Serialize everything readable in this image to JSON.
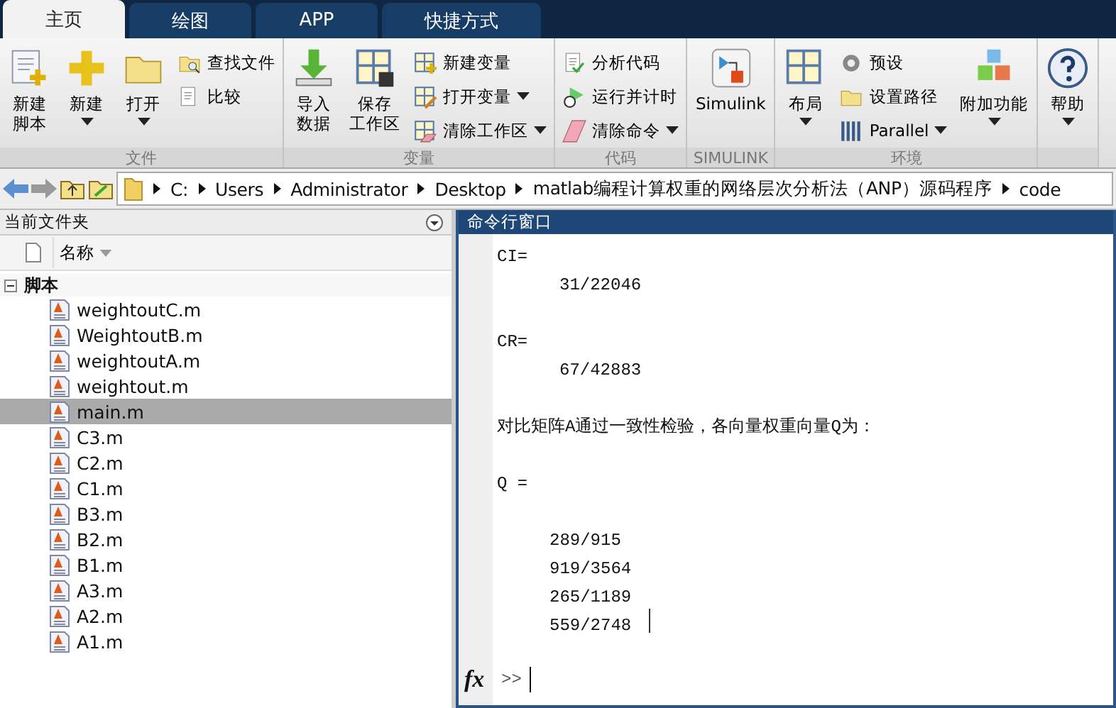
{
  "tabs": [
    {
      "label": "主页",
      "selected": true
    },
    {
      "label": "绘图",
      "selected": false
    },
    {
      "label": "APP",
      "selected": false
    },
    {
      "label": "快捷方式",
      "selected": false
    }
  ],
  "ribbon": {
    "groups": [
      {
        "label": "文件",
        "columns": [
          {
            "kind": "large",
            "items": [
              {
                "lines": [
                  "新建",
                  "脚本"
                ],
                "dropdown": false
              }
            ]
          },
          {
            "kind": "large",
            "items": [
              {
                "label": "新建",
                "dropdown": true
              }
            ]
          },
          {
            "kind": "large",
            "items": [
              {
                "label": "打开",
                "dropdown": true
              }
            ]
          },
          {
            "kind": "small",
            "items": [
              {
                "label": "查找文件",
                "dropdown": false
              },
              {
                "label": "比较",
                "dropdown": false
              }
            ]
          }
        ]
      },
      {
        "label": "变量",
        "columns": [
          {
            "kind": "large",
            "items": [
              {
                "lines": [
                  "导入",
                  "数据"
                ],
                "dropdown": false
              }
            ]
          },
          {
            "kind": "large",
            "items": [
              {
                "lines": [
                  "保存",
                  "工作区"
                ],
                "dropdown": false
              }
            ]
          },
          {
            "kind": "small",
            "items": [
              {
                "label": "新建变量",
                "dropdown": false
              },
              {
                "label": "打开变量",
                "dropdown": true
              },
              {
                "label": "清除工作区",
                "dropdown": true
              }
            ]
          }
        ]
      },
      {
        "label": "代码",
        "columns": [
          {
            "kind": "small",
            "items": [
              {
                "label": "分析代码",
                "dropdown": false
              },
              {
                "label": "运行并计时",
                "dropdown": false
              },
              {
                "label": "清除命令",
                "dropdown": true
              }
            ]
          }
        ]
      },
      {
        "label": "SIMULINK",
        "columns": [
          {
            "kind": "large",
            "items": [
              {
                "label": "Simulink",
                "dropdown": false
              }
            ]
          }
        ]
      },
      {
        "label": "环境",
        "columns": [
          {
            "kind": "large",
            "items": [
              {
                "label": "布局",
                "dropdown": true
              }
            ]
          },
          {
            "kind": "small",
            "items": [
              {
                "label": "预设",
                "dropdown": false
              },
              {
                "label": "设置路径",
                "dropdown": false
              },
              {
                "label": "Parallel",
                "dropdown": true
              }
            ]
          },
          {
            "kind": "large",
            "items": [
              {
                "label": "附加功能",
                "dropdown": true
              }
            ]
          }
        ]
      },
      {
        "columns": [
          {
            "kind": "large",
            "items": [
              {
                "label": "帮助",
                "dropdown": true
              }
            ]
          }
        ]
      }
    ]
  },
  "address": {
    "segments": [
      "C:",
      "Users",
      "Administrator",
      "Desktop",
      "matlab编程计算权重的网络层次分析法（ANP）源码程序",
      "code"
    ]
  },
  "file_panel": {
    "title": "当前文件夹",
    "column": "名称",
    "tree": [
      {
        "label": "脚本",
        "expanded": true,
        "children": [
          {
            "label": "weightoutC.m",
            "selected": false
          },
          {
            "label": "WeightoutB.m",
            "selected": false
          },
          {
            "label": "weightoutA.m",
            "selected": false
          },
          {
            "label": "weightout.m",
            "selected": false
          },
          {
            "label": "main.m",
            "selected": true
          },
          {
            "label": "C3.m",
            "selected": false
          },
          {
            "label": "C2.m",
            "selected": false
          },
          {
            "label": "C1.m",
            "selected": false
          },
          {
            "label": "B3.m",
            "selected": false
          },
          {
            "label": "B2.m",
            "selected": false
          },
          {
            "label": "B1.m",
            "selected": false
          },
          {
            "label": "A3.m",
            "selected": false
          },
          {
            "label": "A2.m",
            "selected": false
          },
          {
            "label": "A1.m",
            "selected": false
          }
        ]
      }
    ]
  },
  "command_window": {
    "title": "命令行窗口",
    "blocks": [
      [
        {
          "text": "CI=",
          "kind": "name"
        },
        {
          "text": "31/22046",
          "kind": "scalar"
        }
      ],
      [
        {
          "text": "CR=",
          "kind": "name"
        },
        {
          "text": "67/42883",
          "kind": "scalar"
        }
      ],
      [
        {
          "text": "对比矩阵A通过一致性检验，各向量权重向量Q为：",
          "kind": "message"
        }
      ],
      [
        {
          "text": "Q =",
          "kind": "name"
        }
      ],
      [
        {
          "text": "289/915",
          "kind": "element"
        },
        {
          "text": "919/3564",
          "kind": "element"
        },
        {
          "text": "265/1189",
          "kind": "element"
        },
        {
          "text": "559/2748",
          "kind": "element"
        }
      ]
    ],
    "function_button": "fx",
    "prompt": ">>"
  }
}
